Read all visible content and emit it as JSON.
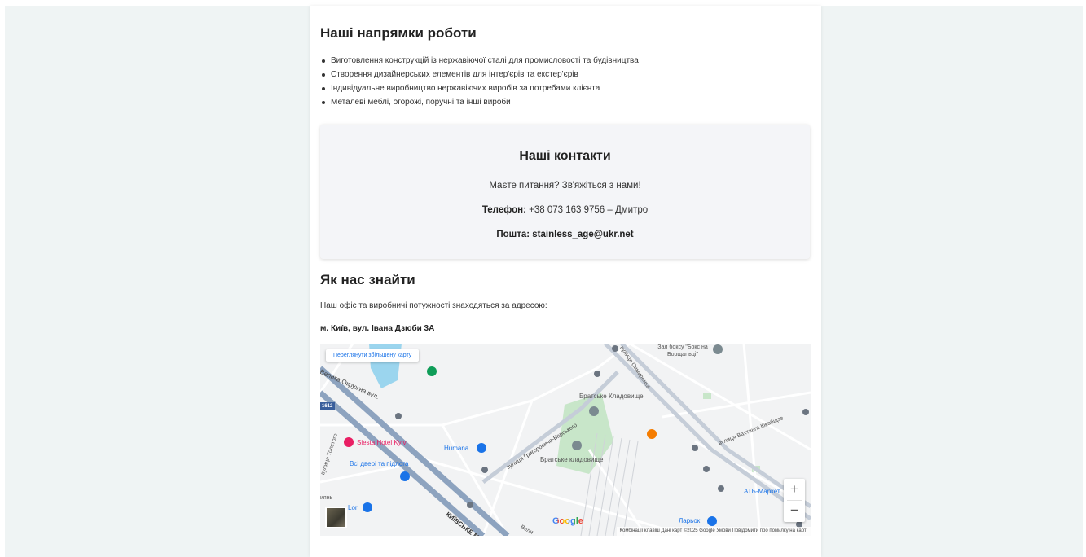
{
  "directions": {
    "title": "Наші напрямки роботи",
    "items": [
      "Виготовлення конструкцій із нержавіючої сталі для промисловості та будівництва",
      "Створення дизайнерських елементів для інтер'єрів та екстер'єрів",
      "Індивідуальне виробництво нержавіючих виробів за потребами клієнта",
      "Металеві меблі, огорожі, поручні та інші вироби"
    ]
  },
  "contacts": {
    "title": "Наші контакти",
    "question": "Маєте питання? Зв'яжіться з нами!",
    "phone_label": "Телефон:",
    "phone_value": "+38 073 163 9756 – Дмитро",
    "email_label": "Пошта:",
    "email_value": "stainless_age@ukr.net"
  },
  "find": {
    "title": "Як нас знайти",
    "intro": "Наш офіс та виробничі потужності знаходяться за адресою:",
    "address": "м. Київ, вул. Івана Дзюби 3А"
  },
  "map": {
    "view_larger": "Переглянути збільшену карту",
    "zoom_in": "+",
    "zoom_out": "−",
    "google": "Google",
    "attribution": "Комбінації клавіш   Дані карт ©2025 Google   Умови   Повідомити про помилку на карті",
    "labels": {
      "box": "Зал боксу \"Бокс на Борщагівці\"",
      "velyka_okruzhna": "Велика Окружна вул.",
      "bratske_kladovyshche_top": "Братське Кладовище",
      "bratske_kladovyshche": "Братське кладовище",
      "kikabidze": "вулиця Вахтанга Кікабідзе",
      "barskoho": "вулиця Григоровича-Барського",
      "siesta": "Siesta Hotel Kyiv",
      "humana": "Humana",
      "dveri": "Всі двері та підлога",
      "atb": "АТБ-Маркет",
      "larok": "Ларьок",
      "lori": "Lori",
      "tolstoho": "вулиця Толстого",
      "road_number": "1612",
      "kyiv": "КИЇВСЬКЕ МІСТО",
      "simyrenka": "вулиця Симиренка",
      "yan": "иянь",
      "velyka": "Вели"
    },
    "colors": {
      "road_major": "#8da3bf",
      "road_minor": "#ffffff",
      "park": "#c8e6c9",
      "water": "#9bd5ee",
      "poi_blue": "#1a73e8",
      "poi_pink": "#e91e63",
      "poi_orange": "#f57c00",
      "poi_green": "#0f9d58"
    }
  }
}
